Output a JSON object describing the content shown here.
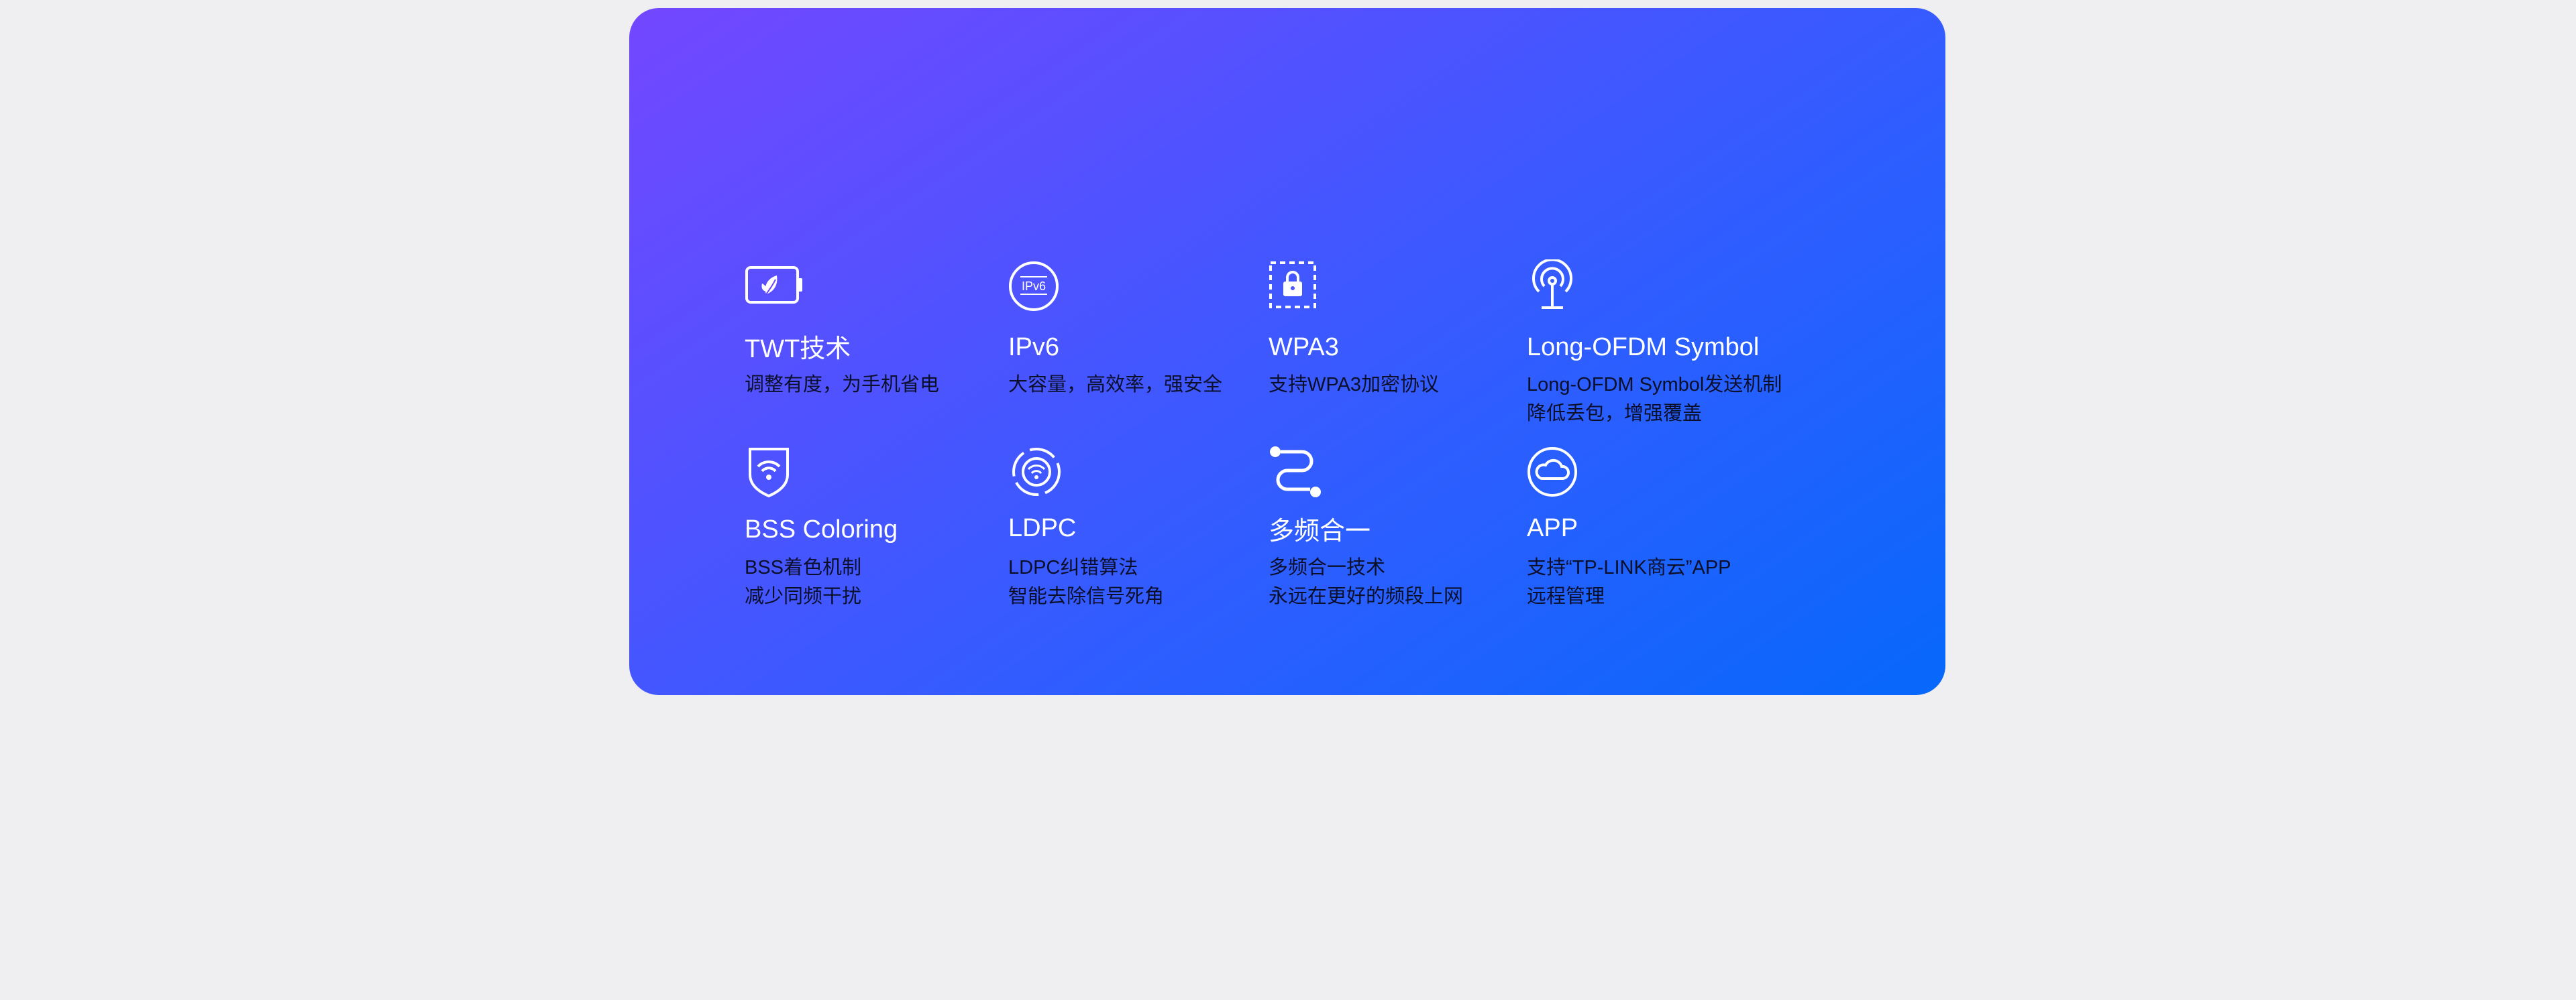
{
  "page": {
    "background": "#efeff1",
    "card_gradient": [
      "#7347ff",
      "#0768fb"
    ],
    "title_color": "#ffffff",
    "desc_color": "#0b0f2a"
  },
  "features": [
    {
      "icon": "battery-leaf-icon",
      "title": "TWT技术",
      "desc": [
        "调整有度，为手机省电"
      ]
    },
    {
      "icon": "ipv6-icon",
      "title": "IPv6",
      "desc": [
        "大容量，高效率，强安全"
      ]
    },
    {
      "icon": "lock-frame-icon",
      "title": "WPA3",
      "desc": [
        "支持WPA3加密协议"
      ]
    },
    {
      "icon": "antenna-icon",
      "title": "Long-OFDM Symbol",
      "desc": [
        "Long-OFDM Symbol发送机制",
        "降低丢包，增强覆盖"
      ]
    },
    {
      "icon": "shield-wifi-icon",
      "title": "BSS Coloring",
      "desc": [
        "BSS着色机制",
        "减少同频干扰"
      ]
    },
    {
      "icon": "signal-circle-icon",
      "title": "LDPC",
      "desc": [
        "LDPC纠错算法",
        "智能去除信号死角"
      ]
    },
    {
      "icon": "band-merge-icon",
      "title": "多频合一",
      "desc": [
        "多频合一技术",
        "永远在更好的频段上网"
      ]
    },
    {
      "icon": "cloud-icon",
      "title": "APP",
      "desc": [
        "支持“TP-LINK商云”APP",
        "远程管理"
      ]
    }
  ]
}
